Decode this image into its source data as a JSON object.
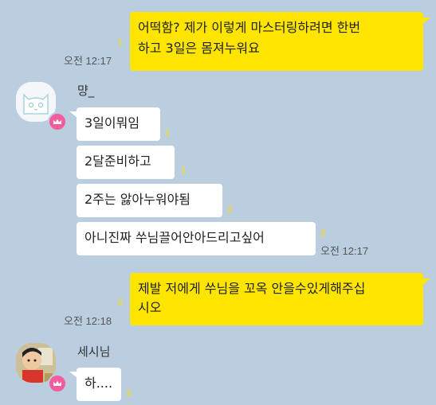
{
  "messages": {
    "m1": {
      "line1": "어떡함? 제가 이렇게 마스터링하려면 한번",
      "line2": "하고 3일은 몸져누워요",
      "unread": "1",
      "time": "오전 12:17"
    },
    "sender1": {
      "name": "먕_"
    },
    "m2": {
      "text": "3일이뭐임",
      "unread": "1"
    },
    "m3": {
      "text": "2달준비하고",
      "unread": "1"
    },
    "m4": {
      "text": "2주는 앓아누워야됨",
      "unread": "2"
    },
    "m5": {
      "text": "아니진짜 쑤님끌어안아드리고싶어",
      "unread": "2",
      "time": "오전 12:17"
    },
    "m6": {
      "line1": "제발 저에게 쑤님을 꼬옥 안을수있게해주십",
      "line2": "시오",
      "unread": "3",
      "time": "오전 12:18"
    },
    "sender2": {
      "name": "세시님"
    },
    "m7": {
      "text": "하....",
      "unread": "3"
    }
  },
  "colors": {
    "background": "#bacee0",
    "my_bubble": "#fee500",
    "other_bubble": "#ffffff",
    "unread": "#e8d94a",
    "crown_badge": "#f45c9c"
  },
  "icons": {
    "avatar1": "white-cat-avatar",
    "avatar2": "cartoon-boy-avatar",
    "badge": "crown-icon"
  }
}
